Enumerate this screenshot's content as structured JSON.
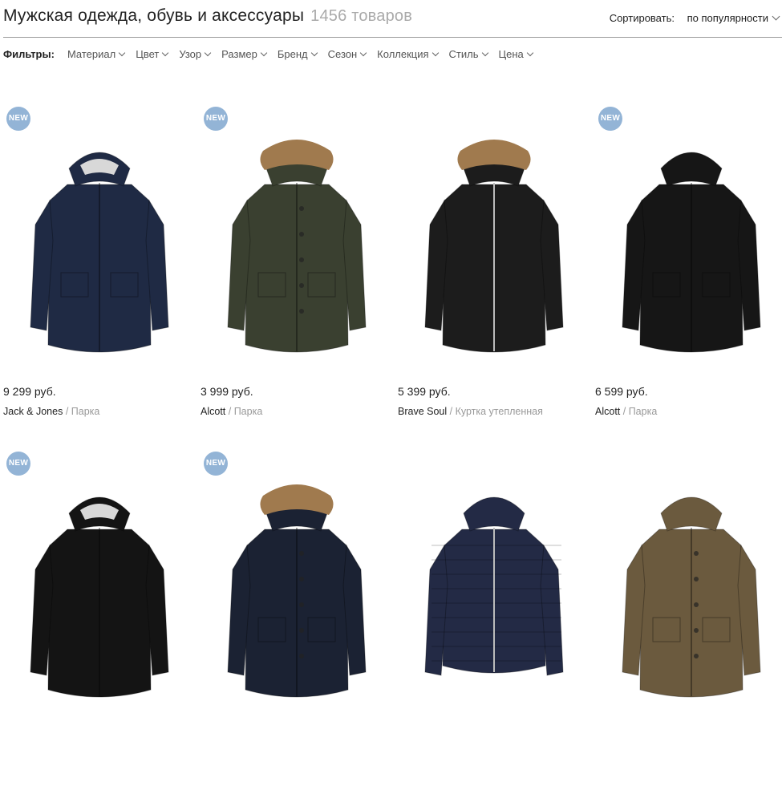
{
  "header": {
    "title": "Мужская одежда, обувь и аксессуары",
    "count": "1456 товаров",
    "sort_label": "Сортировать:",
    "sort_value": "по популярности"
  },
  "filters": {
    "label": "Фильтры:",
    "items": [
      "Материал",
      "Цвет",
      "Узор",
      "Размер",
      "Бренд",
      "Сезон",
      "Коллекция",
      "Стиль",
      "Цена"
    ]
  },
  "products": [
    {
      "badge": "NEW",
      "price": "9 299 руб.",
      "brand": "Jack & Jones",
      "separator": " / ",
      "category": "Парка",
      "color": "#1f2a44",
      "icon": "navy-parka-image"
    },
    {
      "badge": "NEW",
      "price": "3 999 руб.",
      "brand": "Alcott",
      "separator": " / ",
      "category": "Парка",
      "color": "#3a4030",
      "icon": "olive-fur-parka-image"
    },
    {
      "badge": "",
      "price": "5 399 руб.",
      "brand": "Brave Soul",
      "separator": " / ",
      "category": "Куртка утепленная",
      "color": "#1c1c1c",
      "icon": "black-zip-jacket-image"
    },
    {
      "badge": "NEW",
      "price": "6 599 руб.",
      "brand": "Alcott",
      "separator": " / ",
      "category": "Парка",
      "color": "#161616",
      "icon": "black-parka-image"
    },
    {
      "badge": "NEW",
      "price": "",
      "brand": "",
      "separator": "",
      "category": "",
      "color": "#141414",
      "icon": "black-long-parka-image"
    },
    {
      "badge": "NEW",
      "price": "",
      "brand": "",
      "separator": "",
      "category": "",
      "color": "#1b2233",
      "icon": "navy-fur-parka-image"
    },
    {
      "badge": "",
      "price": "",
      "brand": "",
      "separator": "",
      "category": "",
      "color": "#232a45",
      "icon": "navy-puffer-jacket-image"
    },
    {
      "badge": "",
      "price": "",
      "brand": "",
      "separator": "",
      "category": "",
      "color": "#6b5a3e",
      "icon": "khaki-field-jacket-image"
    }
  ],
  "colors": {
    "badge": "#93b4d6",
    "muted": "#999999",
    "fur": "#a07a4e"
  }
}
